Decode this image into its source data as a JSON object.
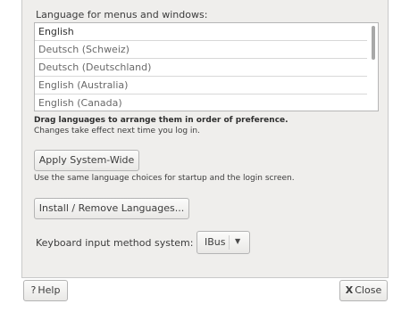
{
  "window": {
    "languages_header": "Language for menus and windows:",
    "languages": [
      "English",
      "Deutsch (Schweiz)",
      "Deutsch (Deutschland)",
      "English (Australia)",
      "English (Canada)"
    ],
    "drag_hint": "Drag languages to arrange them in order of preference.",
    "changes_note": "Changes take effect next time you log in.",
    "apply_button": "Apply System-Wide",
    "startup_note": "Use the same language choices for startup and the login screen.",
    "install_button": "Install / Remove Languages...",
    "input_method_label": "Keyboard input method system:",
    "input_method_value": "IBus"
  },
  "footer": {
    "help_button": "Help",
    "help_glyph": "?",
    "close_button": "Close",
    "close_glyph": "X"
  }
}
